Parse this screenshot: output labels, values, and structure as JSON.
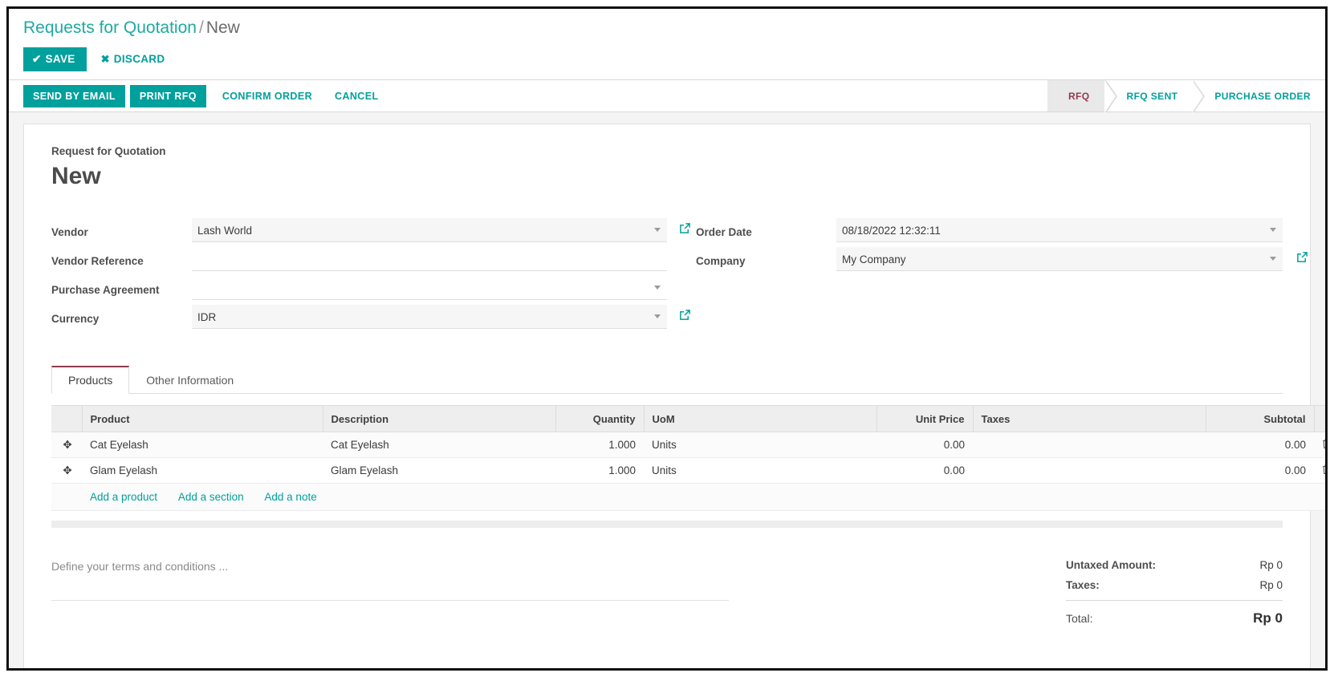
{
  "breadcrumb": {
    "root": "Requests for Quotation",
    "separator": "/",
    "current": "New"
  },
  "control_panel": {
    "save_label": "SAVE",
    "discard_label": "DISCARD",
    "tick_glyph": "✔",
    "x_glyph": "✖"
  },
  "action_bar": {
    "buttons": [
      {
        "label": "SEND BY EMAIL",
        "style": "primary"
      },
      {
        "label": "PRINT RFQ",
        "style": "primary"
      },
      {
        "label": "CONFIRM ORDER",
        "style": "flat"
      },
      {
        "label": "CANCEL",
        "style": "flat"
      }
    ]
  },
  "statusbar": {
    "steps": [
      {
        "label": "RFQ",
        "active": true
      },
      {
        "label": "RFQ SENT",
        "active": false
      },
      {
        "label": "PURCHASE ORDER",
        "active": false
      }
    ],
    "active_color": "#8f3b4f",
    "inactive_color": "#00a09d"
  },
  "record": {
    "subtitle": "Request for Quotation",
    "title": "New"
  },
  "form": {
    "left": [
      {
        "label": "Vendor",
        "value": "Lash World",
        "placeholder": "",
        "dropdown": true,
        "filled": true,
        "external_link": true
      },
      {
        "label": "Vendor Reference",
        "value": "",
        "placeholder": "",
        "dropdown": false,
        "filled": false,
        "external_link": false
      },
      {
        "label": "Purchase Agreement",
        "value": "",
        "placeholder": "",
        "dropdown": true,
        "filled": false,
        "external_link": false
      },
      {
        "label": "Currency",
        "value": "IDR",
        "placeholder": "",
        "dropdown": true,
        "filled": true,
        "external_link": true
      }
    ],
    "right": [
      {
        "label": "Order Date",
        "value": "08/18/2022 12:32:11",
        "placeholder": "",
        "dropdown": true,
        "filled": true,
        "external_link": false
      },
      {
        "label": "Company",
        "value": "My Company",
        "placeholder": "",
        "dropdown": true,
        "filled": true,
        "external_link": true
      }
    ]
  },
  "notebook": {
    "tabs": [
      {
        "label": "Products",
        "active": true
      },
      {
        "label": "Other Information",
        "active": false
      }
    ]
  },
  "lines_table": {
    "columns": [
      "Product",
      "Description",
      "Quantity",
      "UoM",
      "Unit Price",
      "Taxes",
      "Subtotal"
    ],
    "rows": [
      {
        "product": "Cat Eyelash",
        "description": "Cat Eyelash",
        "quantity": "1.000",
        "uom": "Units",
        "unit_price": "0.00",
        "taxes": "",
        "subtotal": "0.00"
      },
      {
        "product": "Glam Eyelash",
        "description": "Glam Eyelash",
        "quantity": "1.000",
        "uom": "Units",
        "unit_price": "0.00",
        "taxes": "",
        "subtotal": "0.00"
      }
    ],
    "add_links": [
      "Add a product",
      "Add a section",
      "Add a note"
    ],
    "handle_glyph": "✥",
    "trash_glyph": "🗑",
    "options_glyph": "⋮"
  },
  "terms": {
    "placeholder": "Define your terms and conditions ..."
  },
  "totals": {
    "untaxed_label": "Untaxed Amount:",
    "untaxed_value": "Rp 0",
    "taxes_label": "Taxes:",
    "taxes_value": "Rp 0",
    "total_label": "Total:",
    "total_value": "Rp 0"
  }
}
